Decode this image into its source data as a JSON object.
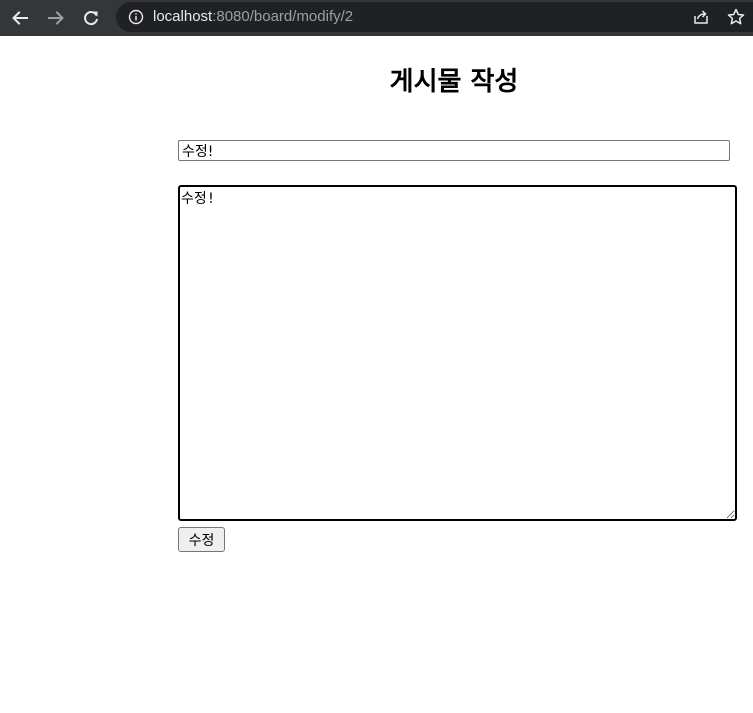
{
  "browser": {
    "url_host": "localhost",
    "url_rest": ":8080/board/modify/2",
    "icons": {
      "back": "arrow-left-icon",
      "forward": "arrow-right-icon",
      "reload": "reload-icon",
      "info": "info-icon",
      "share": "share-icon",
      "bookmark": "star-icon"
    }
  },
  "form": {
    "heading": "게시물 작성",
    "title_value": "수정!",
    "content_value": "수정!",
    "submit_label": "수정"
  },
  "colors": {
    "chrome_bar": "#35363a",
    "omnibox": "#202124",
    "icon": "#e8eaed",
    "icon_disabled": "#9aa0a6"
  }
}
